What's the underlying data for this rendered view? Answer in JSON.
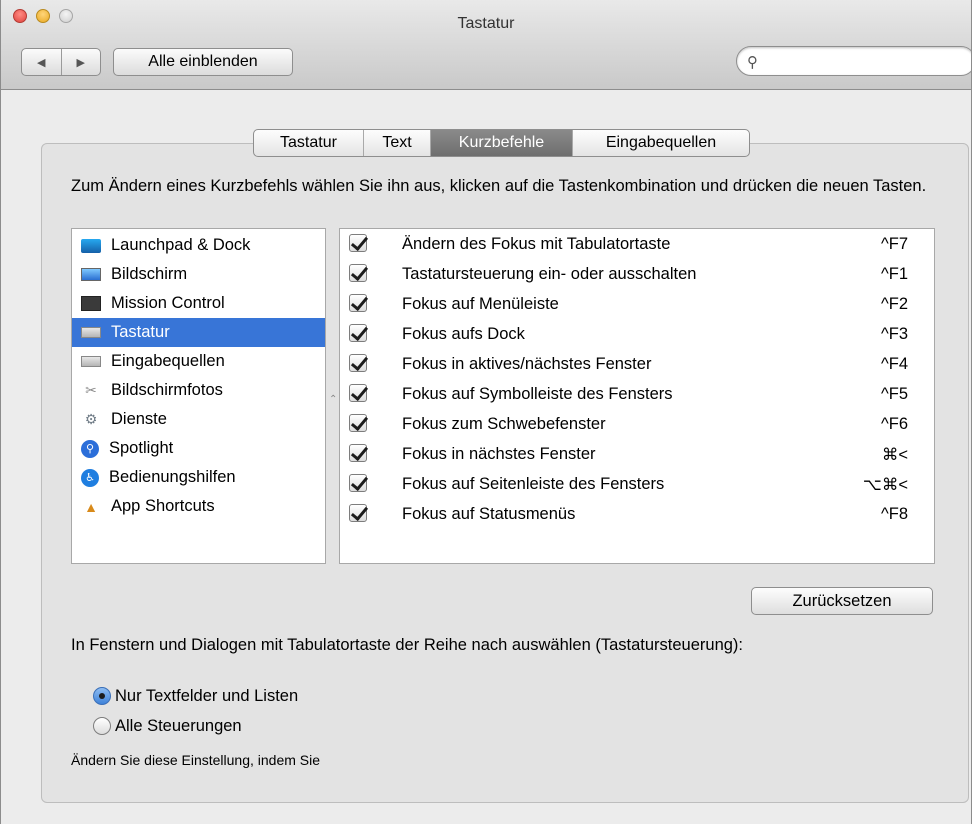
{
  "window": {
    "title": "Tastatur"
  },
  "toolbar": {
    "back_label": "◀",
    "forward_label": "▶",
    "show_all_label": "Alle einblenden",
    "search_placeholder": "",
    "search_icon": "magnifier-icon"
  },
  "tabs": [
    {
      "label": "Tastatur",
      "active": false
    },
    {
      "label": "Text",
      "active": false
    },
    {
      "label": "Kurzbefehle",
      "active": true
    },
    {
      "label": "Eingabequellen",
      "active": false
    }
  ],
  "instructions": "Zum Ändern eines Kurzbefehls wählen Sie ihn aus, klicken auf die Tastenkombination und drücken die neuen Tasten.",
  "categories": [
    {
      "label": "Launchpad & Dock",
      "icon": "launchpad-icon",
      "selected": false
    },
    {
      "label": "Bildschirm",
      "icon": "display-icon",
      "selected": false
    },
    {
      "label": "Mission Control",
      "icon": "mission-control-icon",
      "selected": false
    },
    {
      "label": "Tastatur",
      "icon": "keyboard-icon",
      "selected": true
    },
    {
      "label": "Eingabequellen",
      "icon": "keyboard-icon",
      "selected": false
    },
    {
      "label": "Bildschirmfotos",
      "icon": "screenshot-icon",
      "selected": false
    },
    {
      "label": "Dienste",
      "icon": "gear-icon",
      "selected": false
    },
    {
      "label": "Spotlight",
      "icon": "spotlight-icon",
      "selected": false
    },
    {
      "label": "Bedienungshilfen",
      "icon": "accessibility-icon",
      "selected": false
    },
    {
      "label": "App Shortcuts",
      "icon": "app-store-icon",
      "selected": false
    }
  ],
  "shortcuts": [
    {
      "enabled": true,
      "label": "Ändern des Fokus mit Tabulatortaste",
      "key": "^F7"
    },
    {
      "enabled": true,
      "label": "Tastatursteuerung ein- oder ausschalten",
      "key": "^F1"
    },
    {
      "enabled": true,
      "label": "Fokus auf Menüleiste",
      "key": "^F2"
    },
    {
      "enabled": true,
      "label": "Fokus aufs Dock",
      "key": "^F3"
    },
    {
      "enabled": true,
      "label": "Fokus in aktives/nächstes Fenster",
      "key": "^F4"
    },
    {
      "enabled": true,
      "label": "Fokus auf Symbolleiste des Fensters",
      "key": "^F5"
    },
    {
      "enabled": true,
      "label": "Fokus zum Schwebefenster",
      "key": "^F6"
    },
    {
      "enabled": true,
      "label": "Fokus in nächstes Fenster",
      "key": "⌘<"
    },
    {
      "enabled": true,
      "label": "Fokus auf Seitenleiste des Fensters",
      "key": "⌥⌘<"
    },
    {
      "enabled": true,
      "label": "Fokus auf Statusmenüs",
      "key": "^F8"
    }
  ],
  "reset_label": "Zurücksetzen",
  "tab_navigation": {
    "label": "In Fenstern und Dialogen mit Tabulatortaste der Reihe nach auswählen (Tastatursteuerung):",
    "options": [
      {
        "label": "Nur Textfelder und Listen",
        "selected": true
      },
      {
        "label": "Alle Steuerungen",
        "selected": false
      }
    ],
    "hint": "Ändern Sie diese Einstellung, indem Sie"
  },
  "colors": {
    "selection": "#3875d7",
    "active_tab": "#7a7a7a"
  }
}
